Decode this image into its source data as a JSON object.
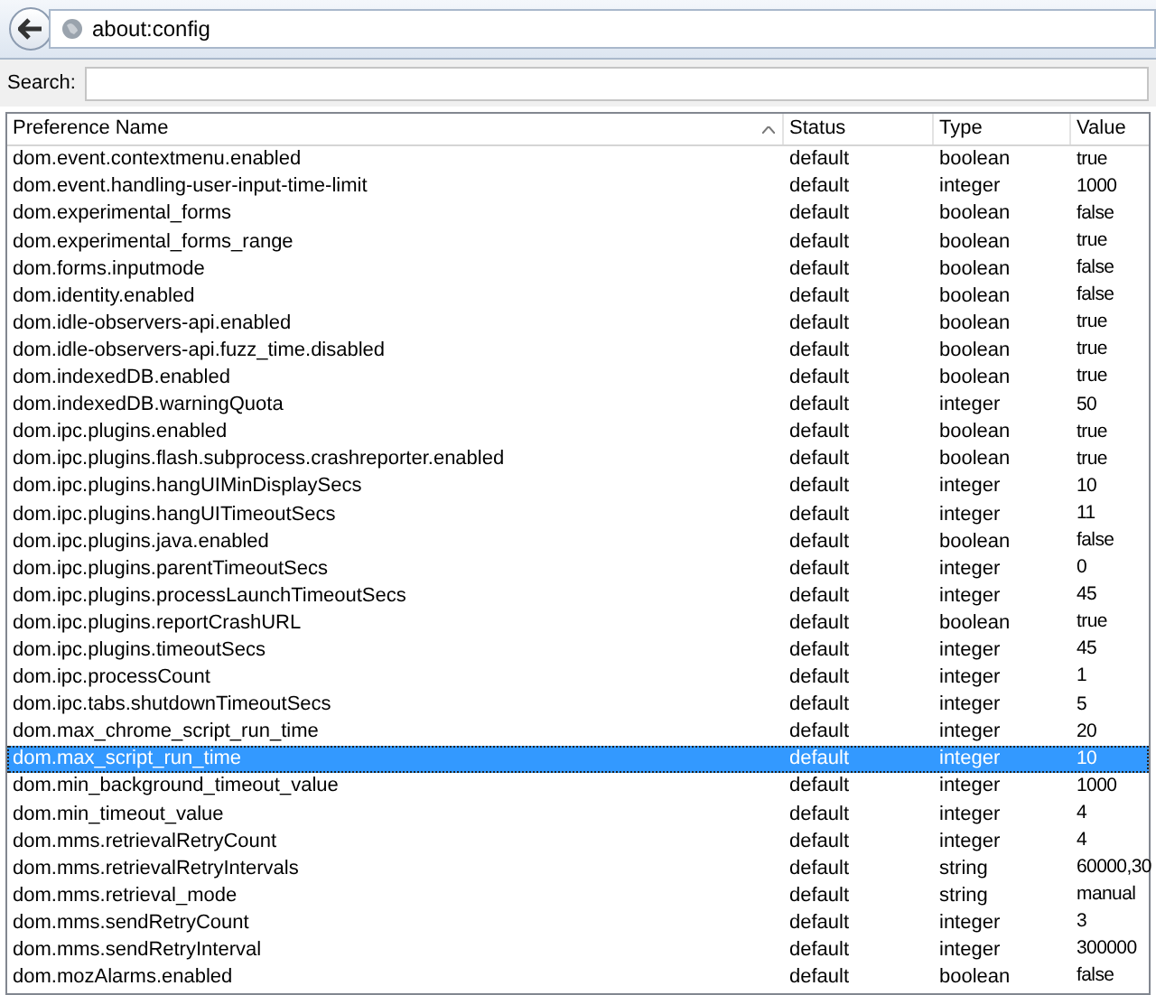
{
  "address_bar": {
    "url": "about:config"
  },
  "search": {
    "label": "Search:"
  },
  "table": {
    "columns": [
      {
        "label": "Preference Name",
        "sorted": true
      },
      {
        "label": "Status",
        "sorted": false
      },
      {
        "label": "Type",
        "sorted": false
      },
      {
        "label": "Value",
        "sorted": false
      }
    ],
    "rows": [
      {
        "name": "dom.event.contextmenu.enabled",
        "status": "default",
        "type": "boolean",
        "value": "true",
        "selected": false
      },
      {
        "name": "dom.event.handling-user-input-time-limit",
        "status": "default",
        "type": "integer",
        "value": "1000",
        "selected": false
      },
      {
        "name": "dom.experimental_forms",
        "status": "default",
        "type": "boolean",
        "value": "false",
        "selected": false
      },
      {
        "name": "dom.experimental_forms_range",
        "status": "default",
        "type": "boolean",
        "value": "true",
        "selected": false
      },
      {
        "name": "dom.forms.inputmode",
        "status": "default",
        "type": "boolean",
        "value": "false",
        "selected": false
      },
      {
        "name": "dom.identity.enabled",
        "status": "default",
        "type": "boolean",
        "value": "false",
        "selected": false
      },
      {
        "name": "dom.idle-observers-api.enabled",
        "status": "default",
        "type": "boolean",
        "value": "true",
        "selected": false
      },
      {
        "name": "dom.idle-observers-api.fuzz_time.disabled",
        "status": "default",
        "type": "boolean",
        "value": "true",
        "selected": false
      },
      {
        "name": "dom.indexedDB.enabled",
        "status": "default",
        "type": "boolean",
        "value": "true",
        "selected": false
      },
      {
        "name": "dom.indexedDB.warningQuota",
        "status": "default",
        "type": "integer",
        "value": "50",
        "selected": false
      },
      {
        "name": "dom.ipc.plugins.enabled",
        "status": "default",
        "type": "boolean",
        "value": "true",
        "selected": false
      },
      {
        "name": "dom.ipc.plugins.flash.subprocess.crashreporter.enabled",
        "status": "default",
        "type": "boolean",
        "value": "true",
        "selected": false
      },
      {
        "name": "dom.ipc.plugins.hangUIMinDisplaySecs",
        "status": "default",
        "type": "integer",
        "value": "10",
        "selected": false
      },
      {
        "name": "dom.ipc.plugins.hangUITimeoutSecs",
        "status": "default",
        "type": "integer",
        "value": "11",
        "selected": false
      },
      {
        "name": "dom.ipc.plugins.java.enabled",
        "status": "default",
        "type": "boolean",
        "value": "false",
        "selected": false
      },
      {
        "name": "dom.ipc.plugins.parentTimeoutSecs",
        "status": "default",
        "type": "integer",
        "value": "0",
        "selected": false
      },
      {
        "name": "dom.ipc.plugins.processLaunchTimeoutSecs",
        "status": "default",
        "type": "integer",
        "value": "45",
        "selected": false
      },
      {
        "name": "dom.ipc.plugins.reportCrashURL",
        "status": "default",
        "type": "boolean",
        "value": "true",
        "selected": false
      },
      {
        "name": "dom.ipc.plugins.timeoutSecs",
        "status": "default",
        "type": "integer",
        "value": "45",
        "selected": false
      },
      {
        "name": "dom.ipc.processCount",
        "status": "default",
        "type": "integer",
        "value": "1",
        "selected": false
      },
      {
        "name": "dom.ipc.tabs.shutdownTimeoutSecs",
        "status": "default",
        "type": "integer",
        "value": "5",
        "selected": false
      },
      {
        "name": "dom.max_chrome_script_run_time",
        "status": "default",
        "type": "integer",
        "value": "20",
        "selected": false
      },
      {
        "name": "dom.max_script_run_time",
        "status": "default",
        "type": "integer",
        "value": "10",
        "selected": true
      },
      {
        "name": "dom.min_background_timeout_value",
        "status": "default",
        "type": "integer",
        "value": "1000",
        "selected": false
      },
      {
        "name": "dom.min_timeout_value",
        "status": "default",
        "type": "integer",
        "value": "4",
        "selected": false
      },
      {
        "name": "dom.mms.retrievalRetryCount",
        "status": "default",
        "type": "integer",
        "value": "4",
        "selected": false
      },
      {
        "name": "dom.mms.retrievalRetryIntervals",
        "status": "default",
        "type": "string",
        "value": "60000,30",
        "selected": false
      },
      {
        "name": "dom.mms.retrieval_mode",
        "status": "default",
        "type": "string",
        "value": "manual",
        "selected": false
      },
      {
        "name": "dom.mms.sendRetryCount",
        "status": "default",
        "type": "integer",
        "value": "3",
        "selected": false
      },
      {
        "name": "dom.mms.sendRetryInterval",
        "status": "default",
        "type": "integer",
        "value": "300000",
        "selected": false
      },
      {
        "name": "dom.mozAlarms.enabled",
        "status": "default",
        "type": "boolean",
        "value": "false",
        "selected": false
      }
    ]
  }
}
